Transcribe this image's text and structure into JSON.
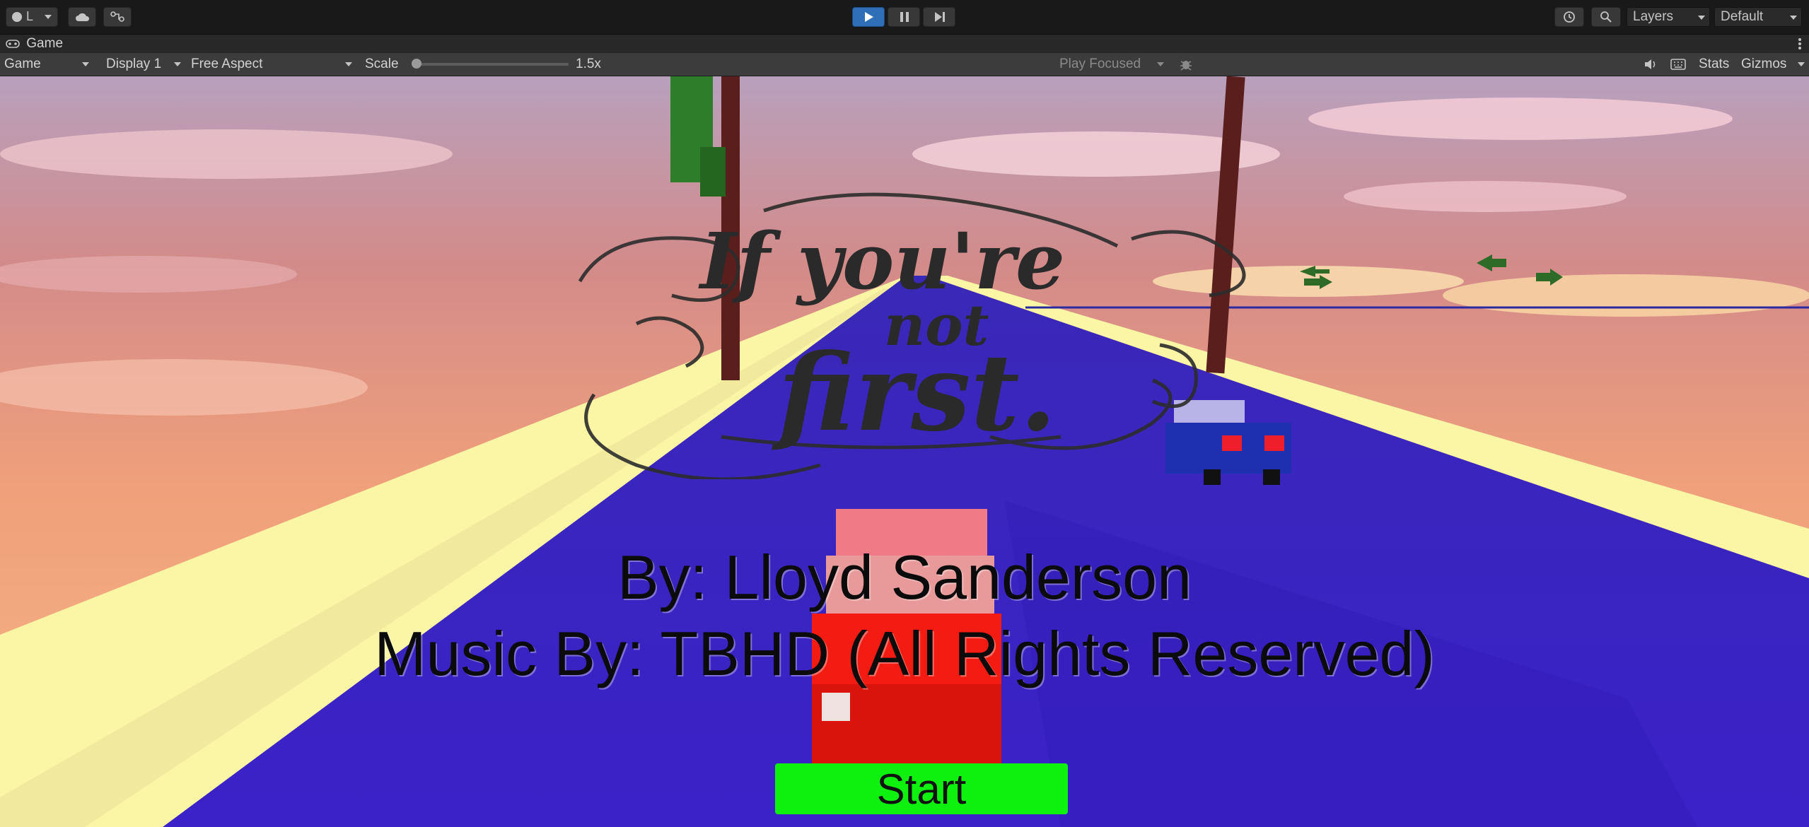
{
  "toolbar": {
    "account_label": "L",
    "layers_label": "Layers",
    "layout_label": "Default"
  },
  "window": {
    "tab_label": "Game"
  },
  "game_controls": {
    "view_mode": "Game",
    "display": "Display 1",
    "aspect": "Free Aspect",
    "scale_label": "Scale",
    "scale_value": "1.5x",
    "scale_fraction": 0.0,
    "play_mode": "Play Focused",
    "stats_label": "Stats",
    "gizmos_label": "Gizmos"
  },
  "game": {
    "title_lines": [
      "If you're",
      "not",
      "first."
    ],
    "credit_line_1": "By: Lloyd Sanderson",
    "credit_line_2": "Music By: TBHD (All Rights Reserved)",
    "start_label": "Start"
  },
  "colors": {
    "sky_top": "#c9a0b4",
    "road": "#3a22c9",
    "road_edge": "#fbf5a6",
    "start_button": "#0ef00e",
    "car_red": "#f41c12",
    "car_blue": "#1e2fb0",
    "play_active": "#2e6fb8"
  },
  "icons": [
    "account-icon",
    "cloud-icon",
    "collab-icon",
    "play-icon",
    "pause-icon",
    "step-icon",
    "history-icon",
    "search-icon",
    "game-icon",
    "bug-icon",
    "audio-icon",
    "keyboard-icon",
    "more-icon"
  ]
}
